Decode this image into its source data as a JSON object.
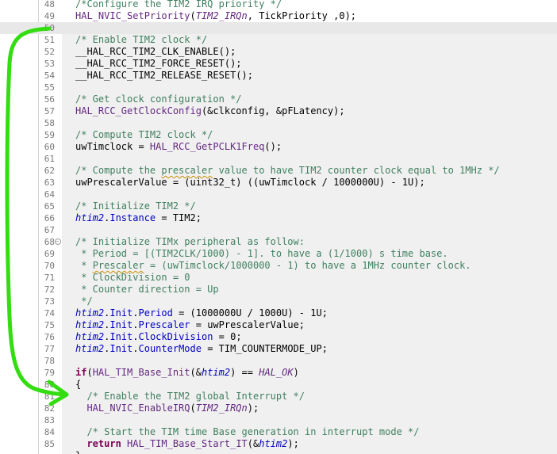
{
  "editor": {
    "lines": [
      {
        "num": "48",
        "tokens": [
          {
            "t": "c",
            "v": "/*Configure the TIM2 IRQ priority */"
          }
        ]
      },
      {
        "num": "49",
        "tokens": [
          {
            "t": "f",
            "v": "HAL_NVIC_SetPriority"
          },
          {
            "t": "p",
            "v": "("
          },
          {
            "t": "m",
            "v": "TIM2_IRQn"
          },
          {
            "t": "p",
            "v": ", TickPriority ,0);"
          }
        ]
      },
      {
        "num": "50",
        "current": true,
        "tokens": []
      },
      {
        "num": "51",
        "tokens": [
          {
            "t": "c",
            "v": "/* Enable TIM2 clock */"
          }
        ]
      },
      {
        "num": "52",
        "tokens": [
          {
            "t": "p",
            "v": "__HAL_RCC_TIM2_CLK_ENABLE();"
          }
        ]
      },
      {
        "num": "53",
        "tokens": [
          {
            "t": "p",
            "v": "__HAL_RCC_TIM2_FORCE_RESET();"
          }
        ]
      },
      {
        "num": "54",
        "tokens": [
          {
            "t": "p",
            "v": "__HAL_RCC_TIM2_RELEASE_RESET();"
          }
        ]
      },
      {
        "num": "55",
        "tokens": []
      },
      {
        "num": "56",
        "tokens": [
          {
            "t": "c",
            "v": "/* Get clock configuration */"
          }
        ]
      },
      {
        "num": "57",
        "tokens": [
          {
            "t": "f",
            "v": "HAL_RCC_GetClockConfig"
          },
          {
            "t": "p",
            "v": "(&clkconfig, &pFLatency);"
          }
        ]
      },
      {
        "num": "58",
        "tokens": []
      },
      {
        "num": "59",
        "tokens": [
          {
            "t": "c",
            "v": "/* Compute TIM2 clock */"
          }
        ]
      },
      {
        "num": "60",
        "tokens": [
          {
            "t": "p",
            "v": "uwTimclock = "
          },
          {
            "t": "f",
            "v": "HAL_RCC_GetPCLK1Freq"
          },
          {
            "t": "p",
            "v": "();"
          }
        ]
      },
      {
        "num": "61",
        "tokens": []
      },
      {
        "num": "62",
        "tokens": [
          {
            "t": "c",
            "v": "/* Compute the "
          },
          {
            "t": "cs",
            "v": "prescaler"
          },
          {
            "t": "c",
            "v": " value to have TIM2 counter clock equal to 1MHz */"
          }
        ]
      },
      {
        "num": "63",
        "tokens": [
          {
            "t": "p",
            "v": "uwPrescalerValue = (uint32_t) ((uwTimclock / 1000000U) - 1U);"
          }
        ]
      },
      {
        "num": "64",
        "tokens": []
      },
      {
        "num": "65",
        "tokens": [
          {
            "t": "c",
            "v": "/* Initialize TIM2 */"
          }
        ]
      },
      {
        "num": "66",
        "tokens": [
          {
            "t": "v",
            "v": "htim2"
          },
          {
            "t": "p",
            "v": "."
          },
          {
            "t": "fl",
            "v": "Instance"
          },
          {
            "t": "p",
            "v": " = TIM2;"
          }
        ]
      },
      {
        "num": "67",
        "tokens": []
      },
      {
        "num": "68",
        "fold": true,
        "tokens": [
          {
            "t": "c",
            "v": "/* Initialize TIMx peripheral as follow:"
          }
        ]
      },
      {
        "num": "69",
        "tokens": [
          {
            "t": "c",
            "v": " * Period = [(TIM2CLK/1000) - 1]. to have a (1/1000) s time base."
          }
        ]
      },
      {
        "num": "70",
        "tokens": [
          {
            "t": "c",
            "v": " * "
          },
          {
            "t": "cs",
            "v": "Prescaler"
          },
          {
            "t": "c",
            "v": " = (uwTimclock/1000000 - 1) to have a 1MHz counter clock."
          }
        ]
      },
      {
        "num": "71",
        "tokens": [
          {
            "t": "c",
            "v": " * ClockDivision = 0"
          }
        ]
      },
      {
        "num": "72",
        "tokens": [
          {
            "t": "c",
            "v": " * Counter direction = Up"
          }
        ]
      },
      {
        "num": "73",
        "tokens": [
          {
            "t": "c",
            "v": " */"
          }
        ]
      },
      {
        "num": "74",
        "tokens": [
          {
            "t": "v",
            "v": "htim2"
          },
          {
            "t": "p",
            "v": "."
          },
          {
            "t": "fl",
            "v": "Init"
          },
          {
            "t": "p",
            "v": "."
          },
          {
            "t": "fl",
            "v": "Period"
          },
          {
            "t": "p",
            "v": " = (1000000U / 1000U) - 1U;"
          }
        ]
      },
      {
        "num": "75",
        "tokens": [
          {
            "t": "v",
            "v": "htim2"
          },
          {
            "t": "p",
            "v": "."
          },
          {
            "t": "fl",
            "v": "Init"
          },
          {
            "t": "p",
            "v": "."
          },
          {
            "t": "fl",
            "v": "Prescaler"
          },
          {
            "t": "p",
            "v": " = uwPrescalerValue;"
          }
        ]
      },
      {
        "num": "76",
        "tokens": [
          {
            "t": "v",
            "v": "htim2"
          },
          {
            "t": "p",
            "v": "."
          },
          {
            "t": "fl",
            "v": "Init"
          },
          {
            "t": "p",
            "v": "."
          },
          {
            "t": "fl",
            "v": "ClockDivision"
          },
          {
            "t": "p",
            "v": " = 0;"
          }
        ]
      },
      {
        "num": "77",
        "tokens": [
          {
            "t": "v",
            "v": "htim2"
          },
          {
            "t": "p",
            "v": "."
          },
          {
            "t": "fl",
            "v": "Init"
          },
          {
            "t": "p",
            "v": "."
          },
          {
            "t": "fl",
            "v": "CounterMode"
          },
          {
            "t": "p",
            "v": " = TIM_COUNTERMODE_UP;"
          }
        ]
      },
      {
        "num": "78",
        "tokens": []
      },
      {
        "num": "79",
        "tokens": [
          {
            "t": "k",
            "v": "if"
          },
          {
            "t": "p",
            "v": "("
          },
          {
            "t": "f",
            "v": "HAL_TIM_Base_Init"
          },
          {
            "t": "p",
            "v": "(&"
          },
          {
            "t": "v",
            "v": "htim2"
          },
          {
            "t": "p",
            "v": ") == "
          },
          {
            "t": "m",
            "v": "HAL_OK"
          },
          {
            "t": "p",
            "v": ")"
          }
        ]
      },
      {
        "num": "80",
        "tokens": [
          {
            "t": "p",
            "v": "{"
          }
        ]
      },
      {
        "num": "81",
        "tokens": [
          {
            "t": "p",
            "v": "  "
          },
          {
            "t": "c",
            "v": "/* Enable the TIM2 global Interrupt */"
          }
        ]
      },
      {
        "num": "82",
        "tokens": [
          {
            "t": "p",
            "v": "  "
          },
          {
            "t": "f",
            "v": "HAL_NVIC_EnableIRQ"
          },
          {
            "t": "p",
            "v": "("
          },
          {
            "t": "m",
            "v": "TIM2_IRQn"
          },
          {
            "t": "p",
            "v": ");"
          }
        ]
      },
      {
        "num": "83",
        "tokens": []
      },
      {
        "num": "84",
        "tokens": [
          {
            "t": "p",
            "v": "  "
          },
          {
            "t": "c",
            "v": "/* Start the TIM time Base generation in interrupt mode */"
          }
        ]
      },
      {
        "num": "85",
        "tokens": [
          {
            "t": "p",
            "v": "  "
          },
          {
            "t": "k",
            "v": "return"
          },
          {
            "t": "p",
            "v": " "
          },
          {
            "t": "f",
            "v": "HAL_TIM_Base_Start_IT"
          },
          {
            "t": "p",
            "v": "(&"
          },
          {
            "t": "v",
            "v": "htim2"
          },
          {
            "t": "p",
            "v": ");"
          }
        ]
      },
      {
        "num": "",
        "tokens": [
          {
            "t": "p",
            "v": "}"
          }
        ]
      }
    ]
  },
  "annotation": {
    "arrow_color": "#33dd11"
  }
}
